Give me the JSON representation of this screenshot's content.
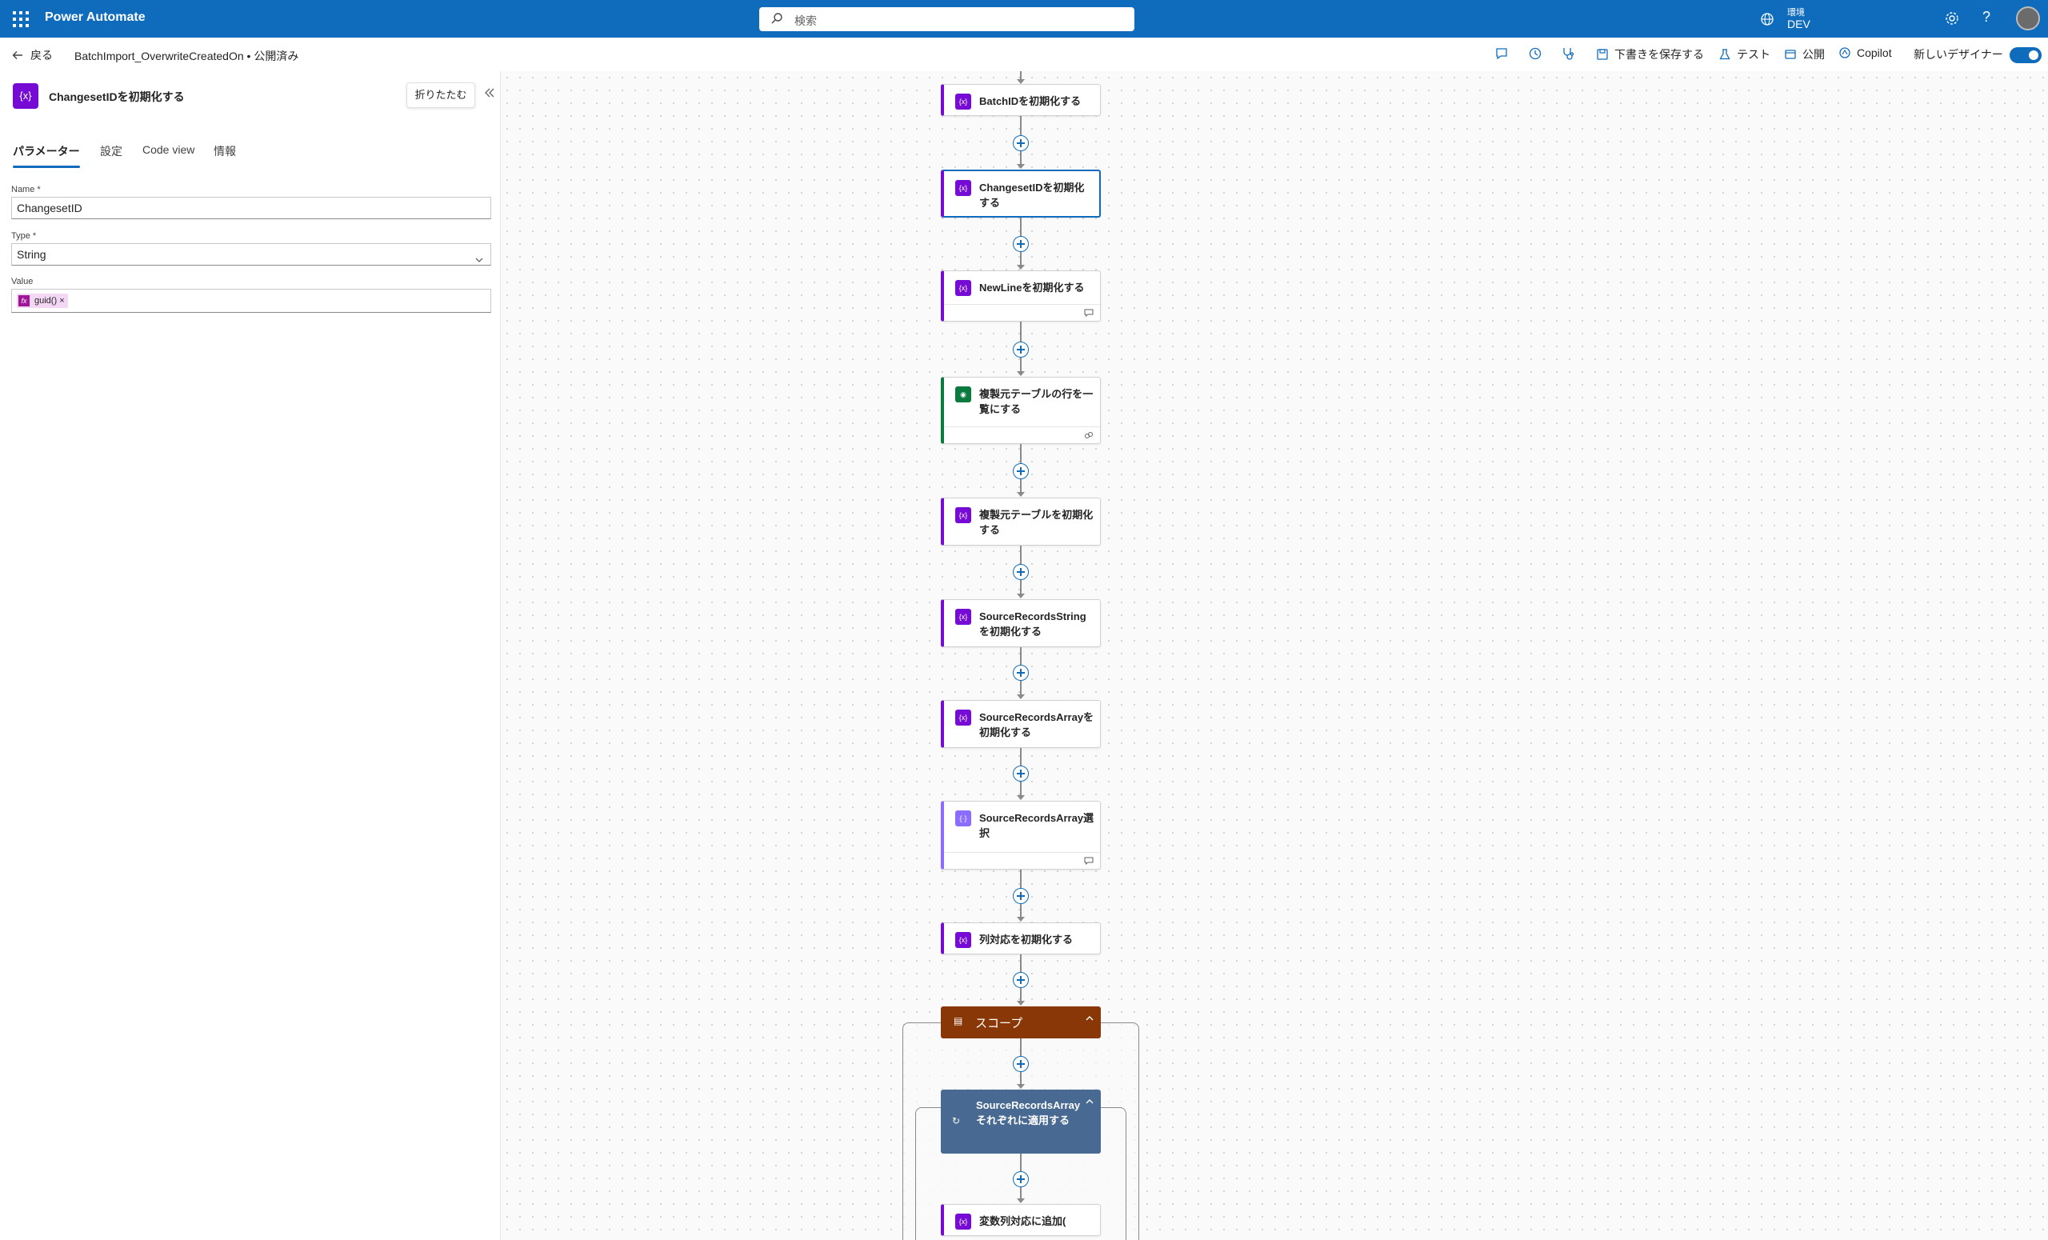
{
  "topbar": {
    "app_name": "Power Automate",
    "search_placeholder": "検索",
    "env_label": "環境",
    "env_name": "DEV"
  },
  "cmdbar": {
    "back_label": "戻る",
    "breadcrumb": "BatchImport_OverwriteCreatedOn • 公開済み",
    "save_draft": "下書きを保存する",
    "test": "テスト",
    "publish": "公開",
    "copilot": "Copilot",
    "new_designer": "新しいデザイナー",
    "new_designer_on": true
  },
  "panel": {
    "title": "ChangesetIDを初期化する",
    "icon_text": "{x}",
    "collapse_label": "折りたたむ",
    "tabs": [
      "パラメーター",
      "設定",
      "Code view",
      "情報"
    ],
    "active_tab": 0,
    "name_label": "Name *",
    "name_value": "ChangesetID",
    "type_label": "Type *",
    "type_value": "String",
    "value_label": "Value",
    "value_token": "guid()",
    "value_token_close": "×"
  },
  "flow": {
    "steps": [
      {
        "title": "BatchIDを初期化する",
        "kind": "variable"
      },
      {
        "title": "ChangesetIDを初期化する",
        "kind": "variable",
        "selected": true
      },
      {
        "title": "NewLineを初期化する",
        "kind": "variable",
        "footer": "comment"
      },
      {
        "title": "複製元テーブルの行を一覧にする",
        "kind": "dataverse",
        "footer": "link"
      },
      {
        "title": "複製元テーブルを初期化する",
        "kind": "variable"
      },
      {
        "title": "SourceRecordsStringを初期化する",
        "kind": "variable"
      },
      {
        "title": "SourceRecordsArrayを初期化する",
        "kind": "variable"
      },
      {
        "title": "SourceRecordsArray選択",
        "kind": "dataop",
        "footer": "comment"
      },
      {
        "title": "列対応を初期化する",
        "kind": "variable"
      }
    ],
    "scope_title": "スコープ",
    "loop_title": "SourceRecordsArrayそれぞれに適用する",
    "inner_step_title": "変数列対応に追加(",
    "colors": {
      "variable": "#770bd6",
      "dataverse": "#0b7a3e",
      "dataop": "#8c6cff",
      "scope": "#8a3707",
      "loop": "#486991",
      "accent": "#0f6cbd"
    }
  }
}
